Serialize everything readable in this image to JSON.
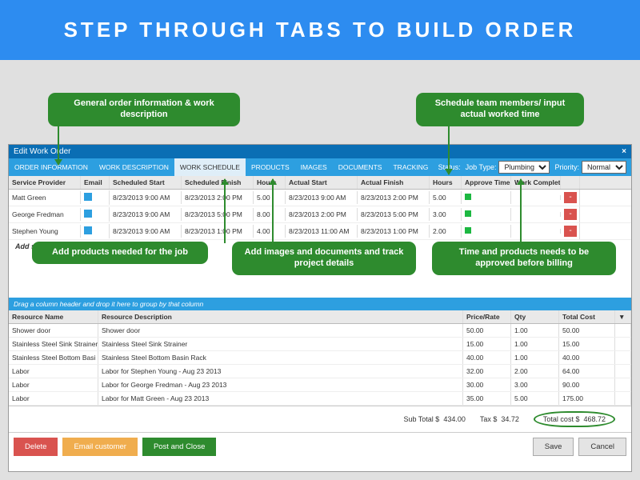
{
  "banner": "STEP  THROUGH  TABS  TO  BUILD  ORDER",
  "callouts": {
    "c1": "General order information  &\nwork description",
    "c2": "Schedule team members/\ninput actual worked time",
    "c3": "Add products needed for the\njob",
    "c4": "Add images and documents and\ntrack project details",
    "c5": "Time  and products needs to be\napproved before billing"
  },
  "window": {
    "title": "Edit Work Order"
  },
  "tabs": [
    "ORDER INFORMATION",
    "WORK DESCRIPTION",
    "WORK SCHEDULE",
    "PRODUCTS",
    "IMAGES",
    "DOCUMENTS",
    "TRACKING"
  ],
  "status_label": "Status:",
  "jobtype_label": "Job Type:",
  "jobtype_value": "Plumbing",
  "priority_label": "Priority:",
  "priority_value": "Normal",
  "sched_cols": [
    "Service Provider",
    "Email",
    "Scheduled Start",
    "Scheduled Finish",
    "Hours",
    "Actual Start",
    "Actual Finish",
    "Hours",
    "Approve Time",
    "Work Complete"
  ],
  "sched_rows": [
    {
      "sp": "Matt Green",
      "ss": "8/23/2013 9:00 AM",
      "sf": "8/23/2013 2:00 PM",
      "h": "5.00",
      "as": "8/23/2013 9:00 AM",
      "af": "8/23/2013 2:00 PM",
      "h2": "5.00"
    },
    {
      "sp": "George Fredman",
      "ss": "8/23/2013 9:00 AM",
      "sf": "8/23/2013 5:00 PM",
      "h": "8.00",
      "as": "8/23/2013 2:00 PM",
      "af": "8/23/2013 5:00 PM",
      "h2": "3.00"
    },
    {
      "sp": "Stephen Young",
      "ss": "8/23/2013 9:00 AM",
      "sf": "8/23/2013 1:00 PM",
      "h": "4.00",
      "as": "8/23/2013 11:00 AM",
      "af": "8/23/2013 1:00 PM",
      "h2": "2.00"
    }
  ],
  "add_schedule": "Add schedule",
  "group_hint": "Drag a column header and drop it here to group by that column",
  "res_cols": [
    "Resource Name",
    "Resource Description",
    "Price/Rate",
    "Qty",
    "Total Cost"
  ],
  "res_rows": [
    {
      "n": "Shower door",
      "d": "Shower door",
      "p": "50.00",
      "q": "1.00",
      "t": "50.00"
    },
    {
      "n": "Stainless Steel Sink Strainer",
      "d": "Stainless Steel Sink Strainer",
      "p": "15.00",
      "q": "1.00",
      "t": "15.00"
    },
    {
      "n": "Stainless Steel Bottom Basi",
      "d": "Stainless Steel Bottom Basin Rack",
      "p": "40.00",
      "q": "1.00",
      "t": "40.00"
    },
    {
      "n": "Labor",
      "d": "Labor for Stephen Young - Aug 23 2013",
      "p": "32.00",
      "q": "2.00",
      "t": "64.00"
    },
    {
      "n": "Labor",
      "d": "Labor for George Fredman - Aug 23 2013",
      "p": "30.00",
      "q": "3.00",
      "t": "90.00"
    },
    {
      "n": "Labor",
      "d": "Labor for Matt Green - Aug 23 2013",
      "p": "35.00",
      "q": "5.00",
      "t": "175.00"
    }
  ],
  "totals": {
    "sub_label": "Sub Total   $",
    "sub": "434.00",
    "tax_label": "Tax   $",
    "tax": "34.72",
    "tot_label": "Total cost   $",
    "tot": "468.72"
  },
  "buttons": {
    "delete": "Delete",
    "email": "Email customer",
    "post": "Post and Close",
    "save": "Save",
    "cancel": "Cancel"
  }
}
